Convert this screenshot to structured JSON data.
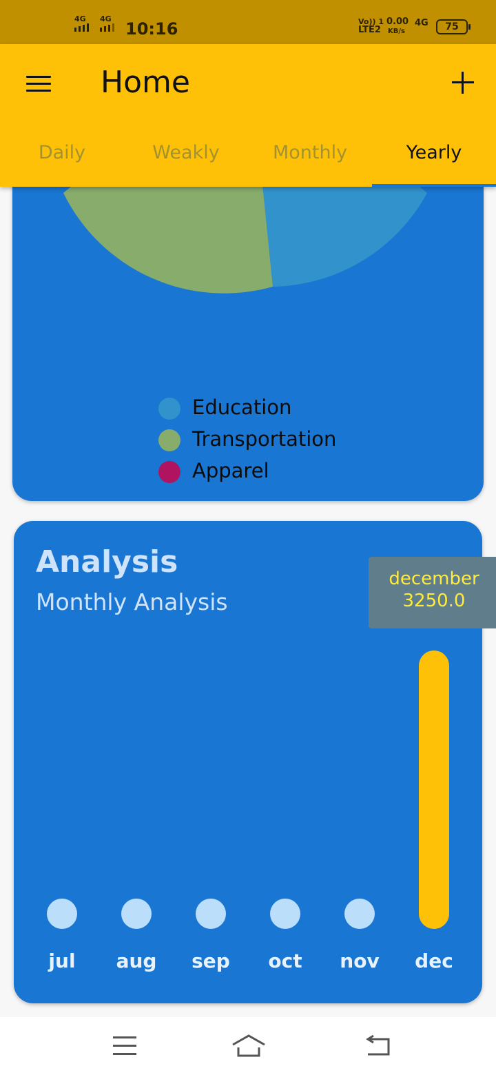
{
  "status_bar": {
    "network_1": "4G",
    "network_2": "4G",
    "time": "10:16",
    "volte_label": "Vo)) 1",
    "lte_label": "LTE2",
    "speed_value": "0.00",
    "speed_unit": "KB/s",
    "network_right": "4G",
    "battery": "75"
  },
  "app_bar": {
    "title": "Home",
    "icons": {
      "menu": "menu-icon",
      "add": "add-icon"
    }
  },
  "tabs": [
    {
      "label": "Daily",
      "active": false
    },
    {
      "label": "Weakly",
      "active": false
    },
    {
      "label": "Monthly",
      "active": false
    },
    {
      "label": "Yearly",
      "active": true
    }
  ],
  "pie_card": {
    "chart_data": {
      "type": "pie",
      "slices": [
        {
          "name": "Education",
          "color": "#3192cc"
        },
        {
          "name": "Transportation",
          "color": "#87ac6c"
        },
        {
          "name": "Apparel",
          "color": "#b0135f"
        }
      ]
    },
    "legend": [
      {
        "label": "Education",
        "color": "#3192cc"
      },
      {
        "label": "Transportation",
        "color": "#87ac6c"
      },
      {
        "label": "Apparel",
        "color": "#b0135f"
      }
    ]
  },
  "analysis_card": {
    "title": "Analysis",
    "subtitle": "Monthly Analysis",
    "tooltip": {
      "month": "december",
      "value": "3250.0"
    },
    "chart_data": {
      "type": "bar",
      "categories": [
        "jul",
        "aug",
        "sep",
        "oct",
        "nov",
        "dec"
      ],
      "values": [
        0,
        0,
        0,
        0,
        0,
        3250.0
      ],
      "bar_color": "#bbdefb",
      "selected_color": "#ffc107",
      "selected_index": 5
    }
  },
  "nav_bar": {
    "icons": [
      "menu-icon",
      "home-icon",
      "back-icon"
    ]
  }
}
